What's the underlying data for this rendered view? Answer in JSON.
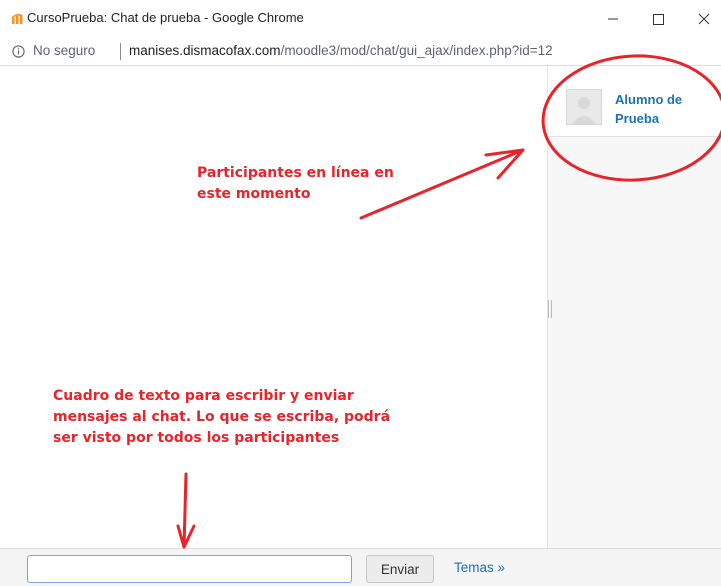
{
  "window": {
    "title": "CursoPrueba: Chat de prueba - Google Chrome",
    "logo_icon": "moodle-logo-icon",
    "controls": [
      "minimize-icon",
      "maximize-icon",
      "close-icon"
    ]
  },
  "address_bar": {
    "security_label": "No seguro",
    "url_host": "manises.dismacofax.com",
    "url_path": "/moodle3/mod/chat/gui_ajax/index.php?id=12"
  },
  "users": [
    {
      "name": "Alumno de Prueba",
      "avatar_icon": "user-avatar-icon"
    }
  ],
  "input_bar": {
    "message_value": "",
    "send_label": "Enviar",
    "themes_label": "Temas »"
  },
  "annotations": {
    "participants": "Participantes en línea en este momento",
    "textbox": "Cuadro de texto para escribir y enviar mensajes al chat. Lo que se escriba, podrá ser visto por todos los participantes",
    "color": "#e8242b"
  },
  "colors": {
    "link": "#1a73b5",
    "input_border": "#7aa7d6"
  }
}
